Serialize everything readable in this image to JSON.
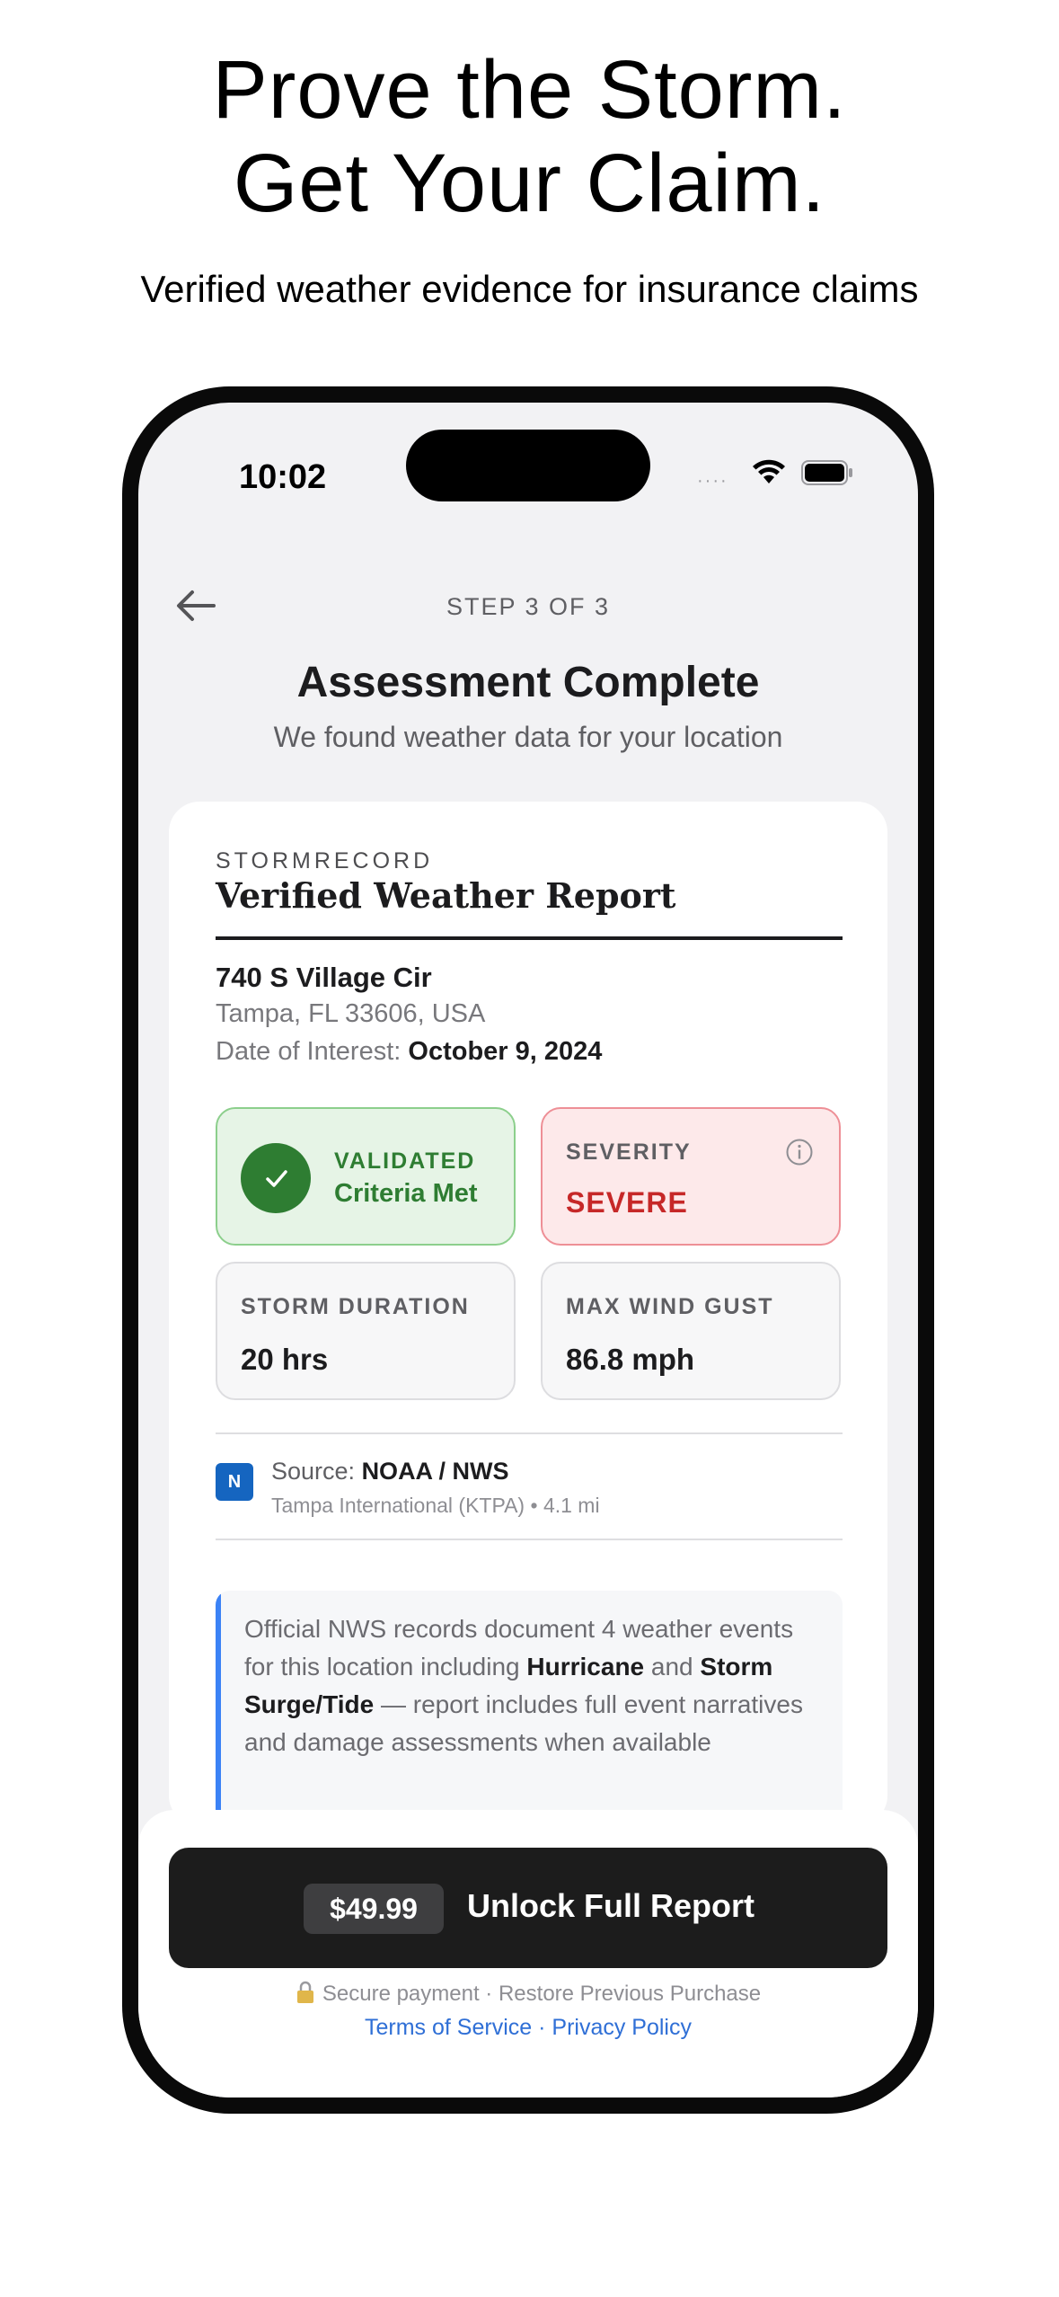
{
  "hero": {
    "title_line1": "Prove the Storm.",
    "title_line2": "Get Your Claim.",
    "subtitle": "Verified weather evidence for insurance claims"
  },
  "status_bar": {
    "time": "10:02",
    "signal": "····"
  },
  "header": {
    "step": "STEP 3 OF 3",
    "title": "Assessment Complete",
    "subtitle": "We found weather data for your location"
  },
  "report": {
    "brand": "STORMRECORD",
    "title": "Verified Weather Report",
    "address_line1": "740 S Village Cir",
    "address_line2": "Tampa, FL 33606, USA",
    "date_label": "Date of Interest: ",
    "date_value": "October 9, 2024",
    "validation": {
      "label": "VALIDATED",
      "status": "Criteria Met",
      "color": "#2e7d32"
    },
    "severity": {
      "label": "SEVERITY",
      "value": "SEVERE",
      "color": "#c62828"
    },
    "duration": {
      "label": "STORM DURATION",
      "value": "20 hrs"
    },
    "wind_gust": {
      "label": "MAX WIND GUST",
      "value": "86.8 mph"
    },
    "source": {
      "badge": "N",
      "label": "Source: ",
      "value": "NOAA / NWS",
      "station": "Tampa International (KTPA)",
      "separator": " • ",
      "distance": "4.1 mi"
    },
    "summary": {
      "part1": "Official NWS records document 4 weather events for this location including ",
      "bold1": "Hurricane",
      "part2": " and ",
      "bold2": "Storm Surge/Tide",
      "part3": " — report includes full event narratives and damage assessments when available"
    }
  },
  "purchase": {
    "price": "$49.99",
    "cta_label": "Unlock Full Report",
    "secure": "Secure payment",
    "dot": " · ",
    "restore": "Restore Previous Purchase",
    "terms": "Terms of Service",
    "privacy": "Privacy Policy"
  },
  "colors": {
    "accent_blue": "#2f6fd6",
    "summary_bar": "#3b82f6",
    "noaa_blue": "#1565c0"
  }
}
